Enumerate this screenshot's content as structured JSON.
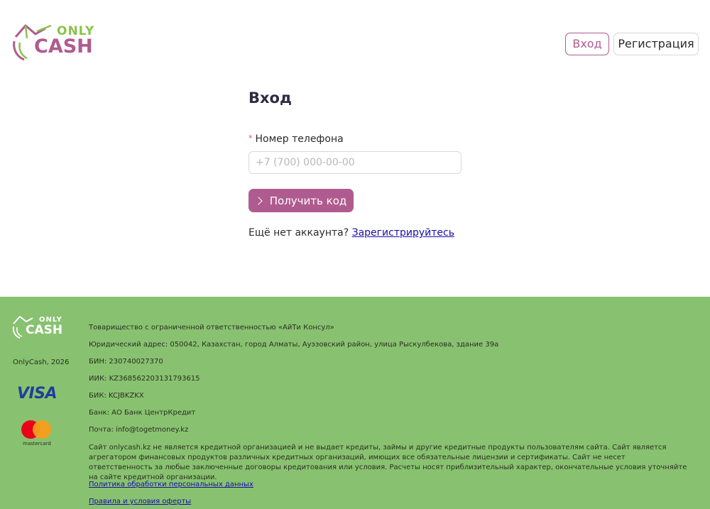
{
  "brand": {
    "name_top": "ONLY",
    "name_bottom": "CASH"
  },
  "header": {
    "login_label": "Вход",
    "register_label": "Регистрация"
  },
  "form": {
    "title": "Вход",
    "phone_label": "Номер телефона",
    "required_mark": "*",
    "phone_placeholder": "+7 (700) 000-00-00",
    "phone_value": "",
    "submit_label": "Получить код",
    "no_account_text": "Ещё нет аккаунта?",
    "register_link": "Зарегистрируйтесь"
  },
  "footer": {
    "logo_top": "ONLY",
    "logo_bottom": "CASH",
    "copyright": "OnlyCash, 2026",
    "visa_label": "VISA",
    "mastercard_label": "mastercard",
    "company": "Товарищество с ограниченной ответственностью «АйТи Консул»",
    "address": "Юридический адрес: 050042, Казахстан, город Алматы, Ауэзовский район, улица Рыскулбекова, здание 39а",
    "bin": "БИН: 230740027370",
    "iik": "ИИК: KZ368562203131793615",
    "bik": "БИК: KCJBKZKX",
    "bank": "Банк: АО Банк ЦентрКредит",
    "email": "Почта: info@togetmoney.kz",
    "disclaimer": "Сайт onlycash.kz не является кредитной организацией и не выдает кредиты, займы и другие кредитные продукты пользователям сайта. Сайт является агрегатором финансовых продуктов различных кредитных организаций, имющих все обязательные лицензии и сертификаты. Сайт не несет ответственность за любые заключенные договоры кредитования или условия. Расчеты носят приблизительный характер, окончательные условия уточняйте на сайте кредитной организации.",
    "privacy_link": "Политика обработки персональных данных",
    "terms_link": "Правила и условия оферты"
  },
  "colors": {
    "brand_purple": "#b05b8f",
    "brand_green": "#8bc34a",
    "footer_bg": "#88c270"
  }
}
